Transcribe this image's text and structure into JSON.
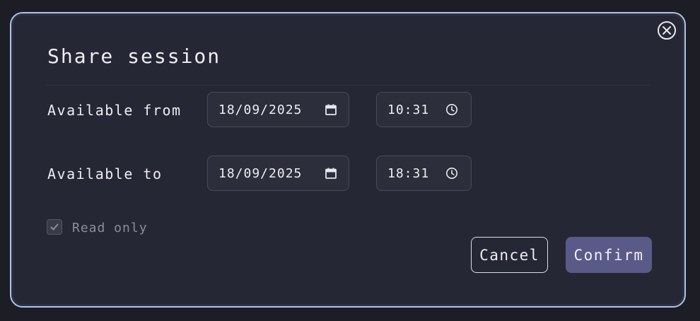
{
  "dialog": {
    "title": "Share session",
    "close_icon": "close-circle-icon"
  },
  "available_from": {
    "label": "Available from",
    "date": "18/09/2025",
    "time": "10:31",
    "date_icon": "calendar-icon",
    "time_icon": "clock-icon"
  },
  "available_to": {
    "label": "Available to",
    "date": "18/09/2025",
    "time": "18:31",
    "date_icon": "calendar-icon",
    "time_icon": "clock-icon"
  },
  "read_only": {
    "label": "Read only",
    "checked": true
  },
  "actions": {
    "cancel_label": "Cancel",
    "confirm_label": "Confirm"
  },
  "colors": {
    "dialog_border": "#a9c5ea",
    "dialog_bg": "#262734",
    "confirm_bg": "#5a5a88"
  }
}
